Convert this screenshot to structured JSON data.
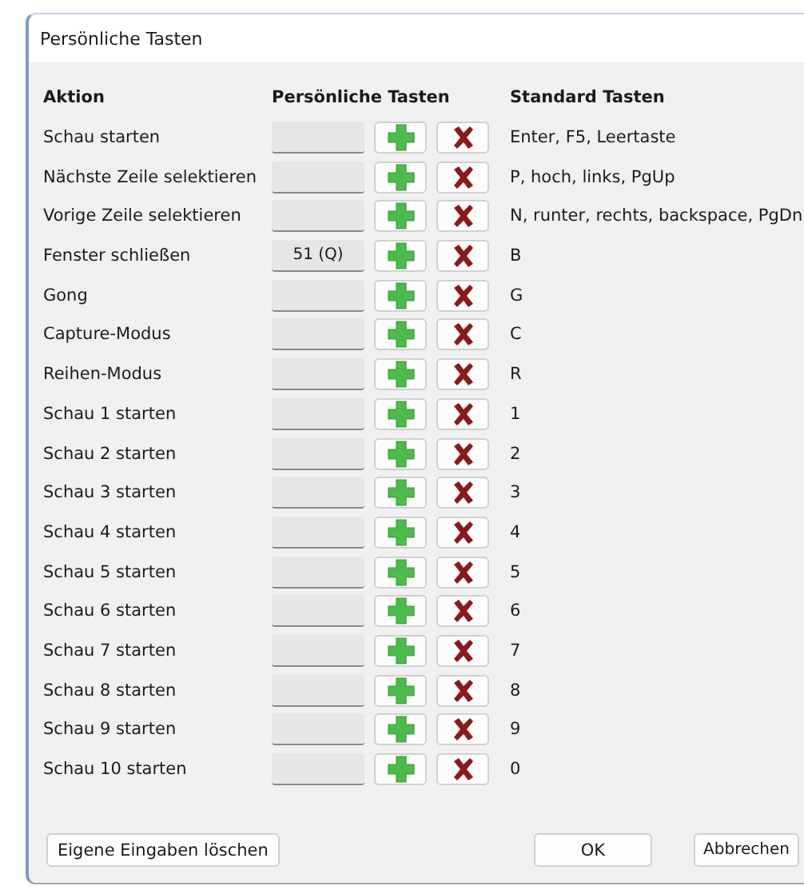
{
  "window": {
    "title": "Persönliche Tasten"
  },
  "columns": [
    "Aktion",
    "Persönliche Tasten",
    "Standard Tasten"
  ],
  "rows": [
    {
      "action": "Schau starten",
      "key": "",
      "standard": "Enter, F5, Leertaste"
    },
    {
      "action": "Nächste Zeile selektieren",
      "key": "",
      "standard": "P, hoch, links, PgUp"
    },
    {
      "action": "Vorige Zeile selektieren",
      "key": "",
      "standard": "N, runter, rechts, backspace, PgDn"
    },
    {
      "action": "Fenster schließen",
      "key": "51 (Q)",
      "standard": "B"
    },
    {
      "action": "Gong",
      "key": "",
      "standard": "G"
    },
    {
      "action": "Capture-Modus",
      "key": "",
      "standard": "C"
    },
    {
      "action": "Reihen-Modus",
      "key": "",
      "standard": "R"
    },
    {
      "action": "Schau 1 starten",
      "key": "",
      "standard": "1"
    },
    {
      "action": "Schau 2 starten",
      "key": "",
      "standard": "2"
    },
    {
      "action": "Schau 3 starten",
      "key": "",
      "standard": "3"
    },
    {
      "action": "Schau 4 starten",
      "key": "",
      "standard": "4"
    },
    {
      "action": "Schau 5 starten",
      "key": "",
      "standard": "5"
    },
    {
      "action": "Schau 6 starten",
      "key": "",
      "standard": "6"
    },
    {
      "action": "Schau 7 starten",
      "key": "",
      "standard": "7"
    },
    {
      "action": "Schau 8 starten",
      "key": "",
      "standard": "8"
    },
    {
      "action": "Schau 9 starten",
      "key": "",
      "standard": "9"
    },
    {
      "action": "Schau 10 starten",
      "key": "",
      "standard": "0"
    }
  ],
  "buttons": {
    "clear": "Eigene Eingaben löschen",
    "ok": "OK",
    "cancel": "Abbrechen"
  }
}
